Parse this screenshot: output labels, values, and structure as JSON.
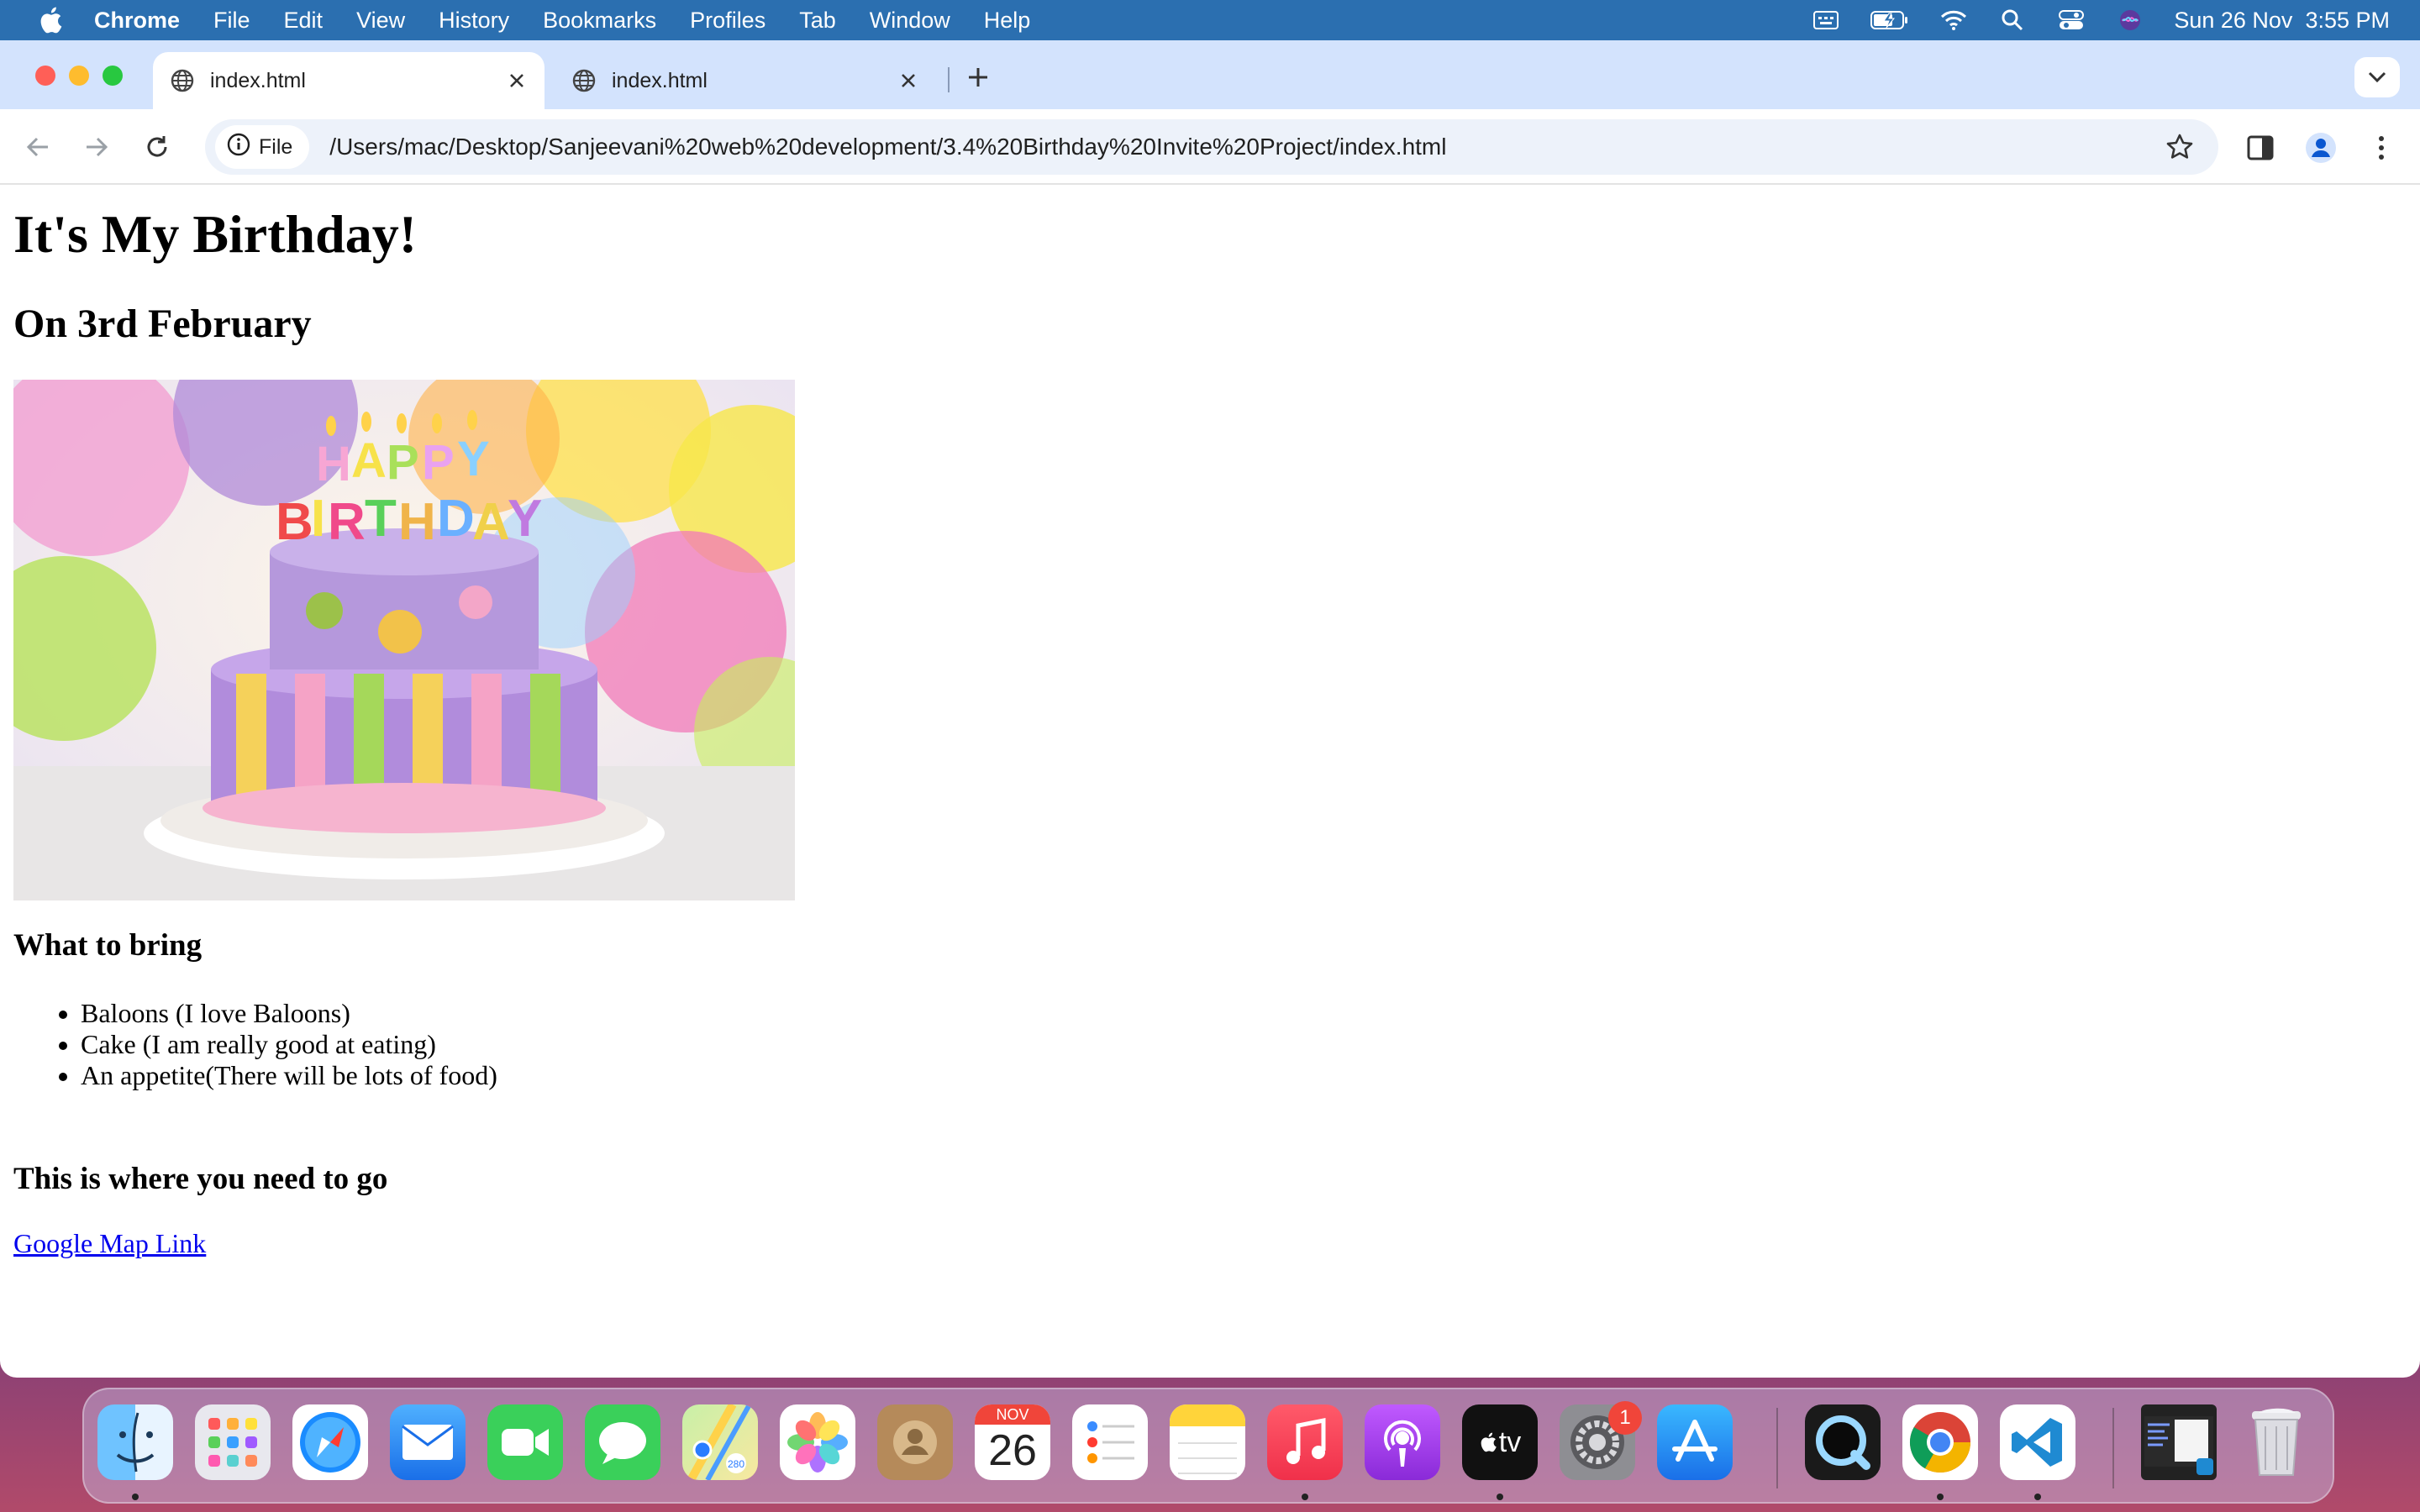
{
  "menubar": {
    "app_name": "Chrome",
    "items": [
      "File",
      "Edit",
      "View",
      "History",
      "Bookmarks",
      "Profiles",
      "Tab",
      "Window",
      "Help"
    ],
    "clock": "Sun 26 Nov  3:55 PM",
    "status_icons": [
      "keyboard-input-icon",
      "battery-charging-icon",
      "wifi-icon",
      "spotlight-search-icon",
      "control-center-icon",
      "siri-icon"
    ]
  },
  "browser": {
    "tabs": [
      {
        "title": "index.html",
        "active": true
      },
      {
        "title": "index.html",
        "active": false
      }
    ],
    "site_chip": "File",
    "url": "/Users/mac/Desktop/Sanjeevani%20web%20development/3.4%20Birthday%20Invite%20Project/index.html"
  },
  "page": {
    "heading": "It's My Birthday!",
    "date": "On 3rd February",
    "image_text": "HAPPY BIRTHDAY",
    "bring_heading": "What to bring",
    "bring_items": [
      "Baloons (I love Baloons)",
      "Cake (I am really good at eating)",
      "An appetite(There will be lots of food)"
    ],
    "where_heading": "This is where you need to go",
    "map_link": "Google Map Link"
  },
  "dock": {
    "apps": [
      "Finder",
      "Launchpad",
      "Safari",
      "Mail",
      "FaceTime",
      "Messages",
      "Maps",
      "Photos",
      "Contacts",
      "Calendar",
      "Reminders",
      "Notes",
      "Music",
      "Podcasts",
      "TV",
      "System Settings",
      "App Store",
      "QuickTime Player",
      "Google Chrome",
      "Visual Studio Code",
      "Screenshot Preview",
      "Trash"
    ],
    "calendar_month": "NOV",
    "calendar_day": "26",
    "settings_badge": "1",
    "tv_label": "tv"
  }
}
